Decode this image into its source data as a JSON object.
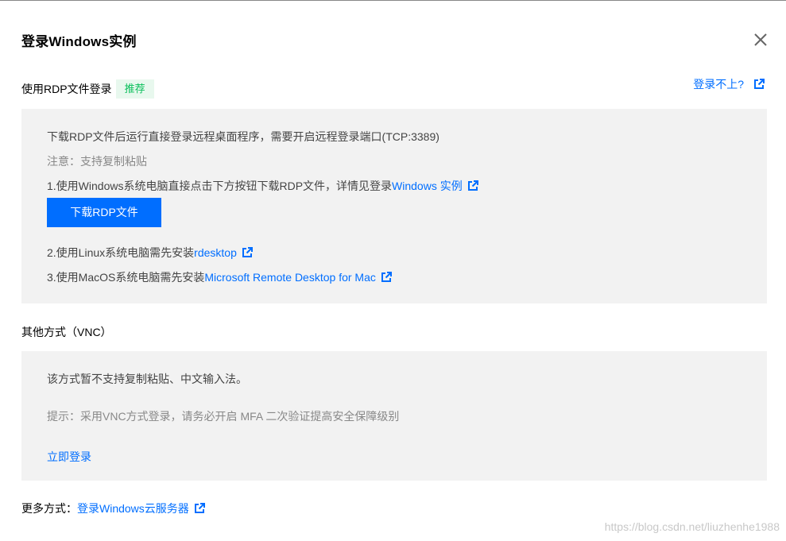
{
  "dialog": {
    "title": "登录Windows实例"
  },
  "rdp": {
    "heading": "使用RDP文件登录",
    "badge": "推荐",
    "help_link": "登录不上?",
    "intro": "下载RDP文件后运行直接登录远程桌面程序，需要开启远程登录端口(TCP:3389)",
    "note": "注意：支持复制粘贴",
    "step1_text": "1.使用Windows系统电脑直接点击下方按钮下载RDP文件，详情见登录 ",
    "step1_link": "Windows 实例",
    "download_button": "下载RDP文件",
    "step2_text": "2.使用Linux系统电脑需先安装 ",
    "step2_link": "rdesktop",
    "step3_text": "3.使用MacOS系统电脑需先安装 ",
    "step3_link": "Microsoft Remote Desktop for Mac"
  },
  "vnc": {
    "heading": "其他方式（VNC）",
    "line1": "该方式暂不支持复制粘贴、中文输入法。",
    "line2": "提示：采用VNC方式登录，请务必开启 MFA 二次验证提高安全保障级别",
    "login_link": "立即登录"
  },
  "more": {
    "label": "更多方式：",
    "link": "登录Windows云服务器"
  },
  "watermark": "https://blog.csdn.net/liuzhenhe1988",
  "colors": {
    "accent": "#006eff",
    "badge_text": "#0abf5b",
    "badge_bg": "#e8f8ee",
    "panel_bg": "#f2f2f2"
  },
  "icons": {
    "close": "close-icon",
    "external": "external-link-icon"
  }
}
